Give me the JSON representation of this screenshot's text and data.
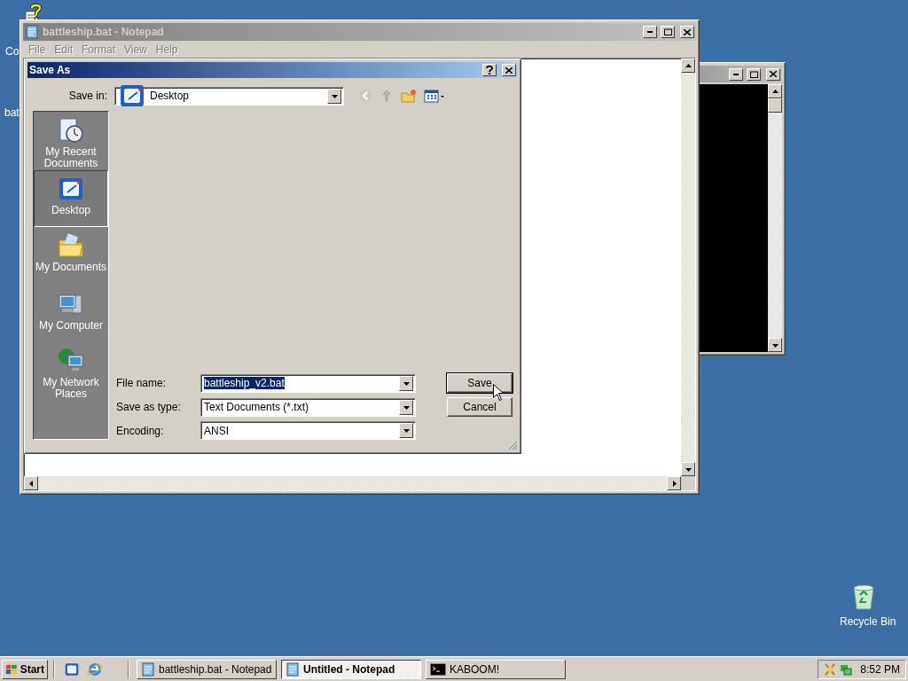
{
  "desktop": {
    "icons": [
      {
        "label": "Co",
        "kind": "computer"
      },
      {
        "label": "bat",
        "kind": "file"
      },
      {
        "label": "Recycle Bin",
        "kind": "bin"
      }
    ]
  },
  "notepad": {
    "title": "battleship.bat - Notepad",
    "active": false,
    "menu": [
      {
        "label": "File"
      },
      {
        "label": "Edit"
      },
      {
        "label": "Format"
      },
      {
        "label": "View"
      },
      {
        "label": "Help"
      }
    ]
  },
  "save_as": {
    "title": "Save As",
    "active": true,
    "save_in": {
      "label": "Save in:",
      "value": "Desktop"
    },
    "places": [
      {
        "label": "My Recent Documents",
        "kind": "recent",
        "selected": false
      },
      {
        "label": "Desktop",
        "kind": "desktop",
        "selected": true
      },
      {
        "label": "My Documents",
        "kind": "documents",
        "selected": false
      },
      {
        "label": "My Computer",
        "kind": "computer",
        "selected": false
      },
      {
        "label": "My Network Places",
        "kind": "network",
        "selected": false
      }
    ],
    "fields": [
      {
        "label": "File name:",
        "value": "battleship_v2.bat",
        "highlighted": true
      },
      {
        "label": "Save as type:",
        "value": "Text Documents (*.txt)",
        "highlighted": false
      },
      {
        "label": "Encoding:",
        "value": "ANSI",
        "highlighted": false
      }
    ],
    "buttons": [
      {
        "label": "Save",
        "default": true
      },
      {
        "label": "Cancel",
        "default": false
      }
    ]
  },
  "taskbar": {
    "start": "Start",
    "tasks": [
      {
        "label": "battleship.bat - Notepad",
        "kind": "notepad",
        "selected": false
      },
      {
        "label": "Untitled - Notepad",
        "kind": "notepad",
        "selected": true
      },
      {
        "label": "KABOOM!",
        "kind": "console",
        "selected": false
      }
    ],
    "clock": "8:52 PM"
  }
}
